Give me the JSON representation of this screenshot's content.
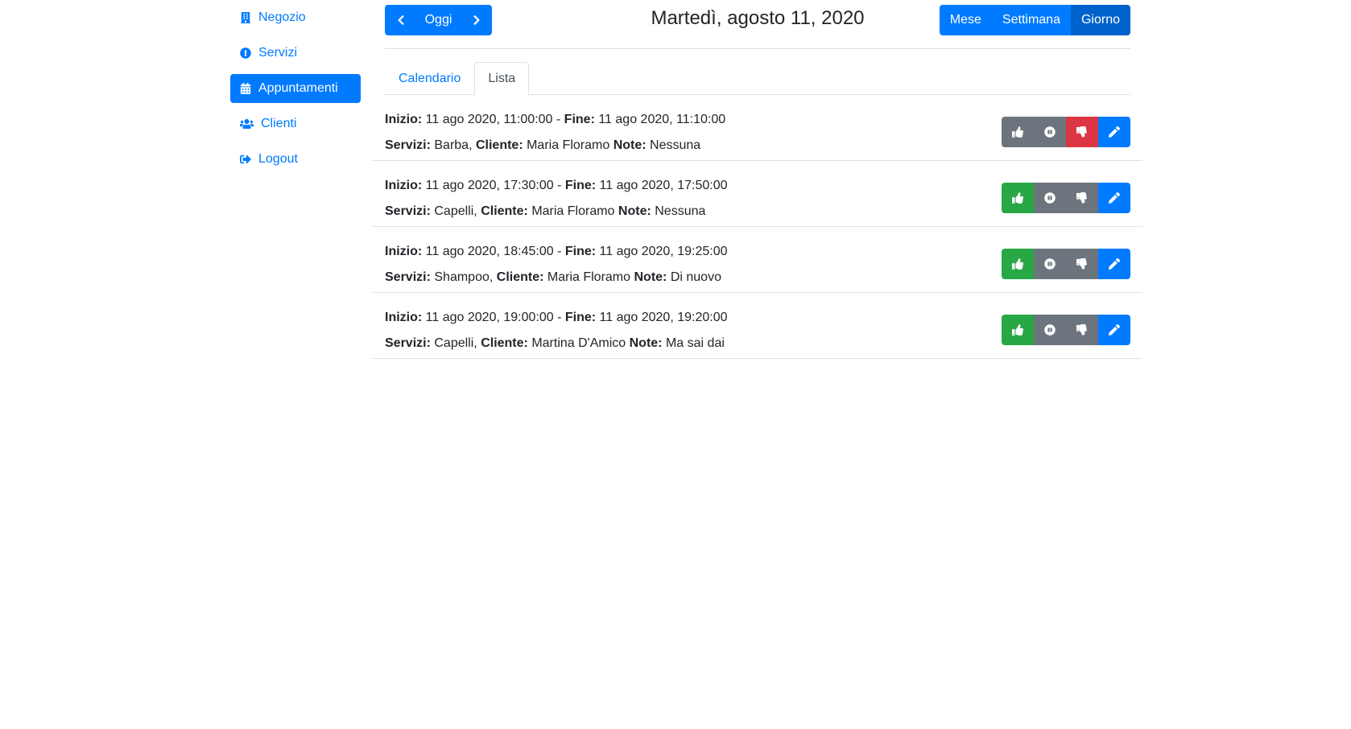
{
  "sidebar": {
    "items": [
      {
        "label": "Negozio",
        "icon": "building-icon"
      },
      {
        "label": "Servizi",
        "icon": "exclamation-circle-icon"
      },
      {
        "label": "Appuntamenti",
        "icon": "calendar-icon",
        "active": true
      },
      {
        "label": "Clienti",
        "icon": "users-icon"
      },
      {
        "label": "Logout",
        "icon": "sign-out-icon"
      }
    ]
  },
  "toolbar": {
    "today_label": "Oggi",
    "title": "Martedì, agosto 11, 2020",
    "views": [
      "Mese",
      "Settimana",
      "Giorno"
    ],
    "active_view": "Giorno"
  },
  "tabs": [
    {
      "label": "Calendario",
      "active": false
    },
    {
      "label": "Lista",
      "active": true
    }
  ],
  "labels": {
    "start": "Inizio:",
    "end": "Fine:",
    "services": "Servizi:",
    "client": "Cliente:",
    "note": "Note:"
  },
  "appointments": [
    {
      "start": "11 ago 2020, 11:00:00",
      "end": "11 ago 2020, 11:10:00",
      "services": "Barba,",
      "client": "Maria Floramo",
      "note": "Nessuna",
      "status": "rejected"
    },
    {
      "start": "11 ago 2020, 17:30:00",
      "end": "11 ago 2020, 17:50:00",
      "services": "Capelli,",
      "client": "Maria Floramo",
      "note": "Nessuna",
      "status": "accepted"
    },
    {
      "start": "11 ago 2020, 18:45:00",
      "end": "11 ago 2020, 19:25:00",
      "services": "Shampoo,",
      "client": "Maria Floramo",
      "note": "Di nuovo",
      "status": "accepted"
    },
    {
      "start": "11 ago 2020, 19:00:00",
      "end": "11 ago 2020, 19:20:00",
      "services": "Capelli,",
      "client": "Martina D'Amico",
      "note": "Ma sai dai",
      "status": "accepted"
    }
  ],
  "colors": {
    "primary": "#007bff",
    "success": "#28a745",
    "danger": "#dc3545",
    "secondary": "#6c757d"
  }
}
